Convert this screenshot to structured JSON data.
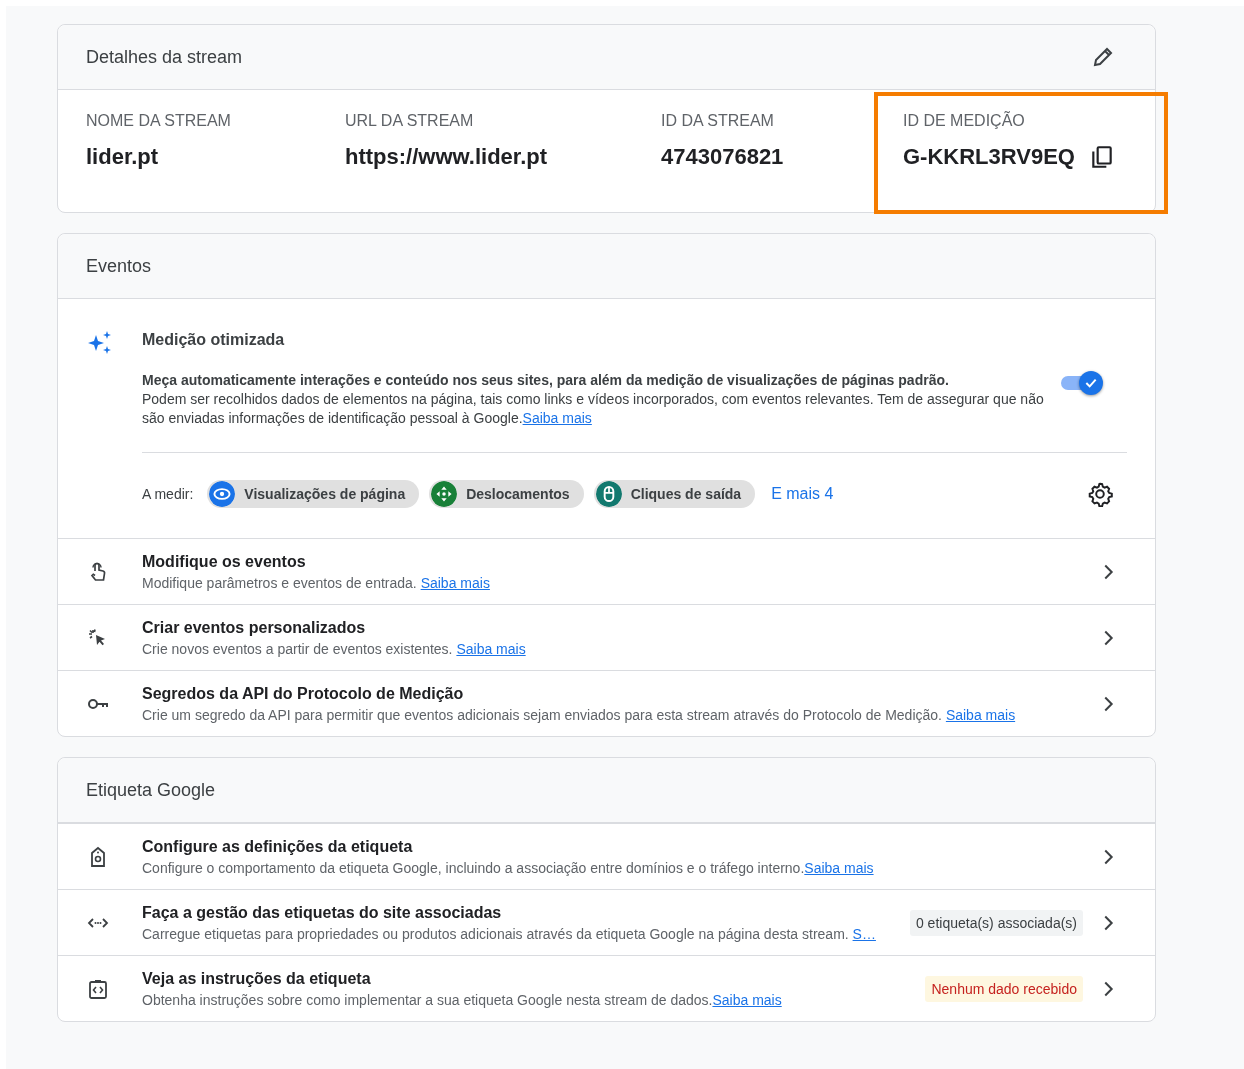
{
  "details": {
    "title": "Detalhes da stream",
    "fields": [
      {
        "label": "NOME DA STREAM",
        "value": "lider.pt",
        "highlighted": false,
        "copyable": false
      },
      {
        "label": "URL DA STREAM",
        "value": "https://www.lider.pt",
        "highlighted": false,
        "copyable": false
      },
      {
        "label": "ID DA STREAM",
        "value": "4743076821",
        "highlighted": false,
        "copyable": false
      },
      {
        "label": "ID DE MEDIÇÃO",
        "value": "G-KKRL3RV9EQ",
        "highlighted": true,
        "copyable": true
      }
    ]
  },
  "events": {
    "title": "Eventos",
    "enhanced": {
      "title": "Medição otimizada",
      "lead": "Meça automaticamente interações e conteúdo nos seus sites, para além da medição de visualizações de páginas padrão.",
      "description": "Podem ser recolhidos dados de elementos na página, tais como links e vídeos incorporados, com eventos relevantes. Tem de assegurar que não são enviadas informações de identificação pessoal à Google.",
      "link": "Saiba mais",
      "on": true,
      "measuring_label": "A medir:",
      "chips": [
        {
          "kind": "page-views",
          "label": "Visualizações de página",
          "color": "#1a73e8"
        },
        {
          "kind": "scrolls",
          "label": "Deslocamentos",
          "color": "#188038"
        },
        {
          "kind": "outbound-clicks",
          "label": "Cliques de saída",
          "color": "#12796f"
        }
      ],
      "more_link": "E mais 4"
    },
    "rows": [
      {
        "kind": "touch",
        "title": "Modifique os eventos",
        "description": "Modifique parâmetros e eventos de entrada. ",
        "link": "Saiba mais"
      },
      {
        "kind": "click",
        "title": "Criar eventos personalizados",
        "description": "Crie novos eventos a partir de eventos existentes. ",
        "link": "Saiba mais"
      },
      {
        "kind": "key",
        "title": "Segredos da API do Protocolo de Medição",
        "description": "Crie um segredo da API para permitir que eventos adicionais sejam enviados para esta stream através do Protocolo de Medição. ",
        "link": "Saiba mais"
      }
    ]
  },
  "tag": {
    "title": "Etiqueta Google",
    "rows": [
      {
        "kind": "tag",
        "title": "Configure as definições da etiqueta",
        "description": "Configure o comportamento da etiqueta Google, incluindo a associação entre domínios e o tráfego interno.",
        "link": "Saiba mais"
      },
      {
        "kind": "code",
        "title": "Faça a gestão das etiquetas do site associadas",
        "description": "Carregue etiquetas para propriedades ou produtos adicionais através da etiqueta Google na página desta stream. ",
        "link": "S…",
        "badge": {
          "label": "0 etiqueta(s) associada(s)",
          "kind": "neutral"
        }
      },
      {
        "kind": "clipboard",
        "title": "Veja as instruções da etiqueta",
        "description": "Obtenha instruções sobre como implementar a sua etiqueta Google nesta stream de dados.",
        "link": "Saiba mais",
        "badge": {
          "label": "Nenhum dado recebido",
          "kind": "warning"
        }
      }
    ]
  }
}
